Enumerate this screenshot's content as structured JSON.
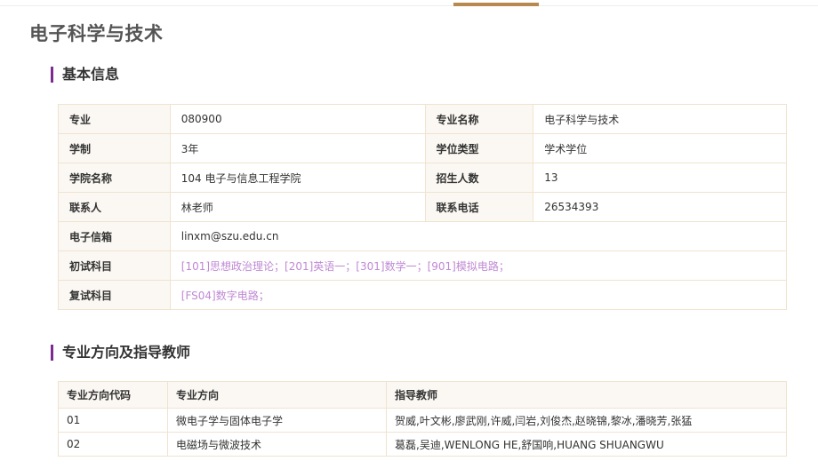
{
  "page_title": "电子科学与技术",
  "sections": {
    "basic_info": "基本信息",
    "directions": "专业方向及指导教师"
  },
  "info": {
    "major_label": "专业",
    "major_value": "080900",
    "major_name_label": "专业名称",
    "major_name_value": "电子科学与技术",
    "duration_label": "学制",
    "duration_value": "3年",
    "degree_type_label": "学位类型",
    "degree_type_value": "学术学位",
    "school_label": "学院名称",
    "school_value": "104 电子与信息工程学院",
    "enrollment_label": "招生人数",
    "enrollment_value": "13",
    "contact_label": "联系人",
    "contact_value": "林老师",
    "phone_label": "联系电话",
    "phone_value": "26534393",
    "email_label": "电子信箱",
    "email_value": "linxm@szu.edu.cn",
    "prelim_label": "初试科目",
    "prelim_value": "[101]思想政治理论；[201]英语一；[301]数学一；[901]模拟电路；",
    "retest_label": "复试科目",
    "retest_value": "[FS04]数字电路；"
  },
  "directions_table": {
    "headers": [
      "专业方向代码",
      "专业方向",
      "指导教师"
    ],
    "rows": [
      [
        "01",
        "微电子学与固体电子学",
        "贺威,叶文彬,廖武刚,许威,闫岩,刘俊杰,赵晓锦,黎冰,潘晓芳,张猛"
      ],
      [
        "02",
        "电磁场与微波技术",
        "葛磊,吴迪,WENLONG HE,舒国响,HUANG SHUANGWU"
      ]
    ]
  },
  "colors": {
    "accent_tab": "#b8894e",
    "section_marker": "#7b2c8f",
    "subject_link": "#c089d4",
    "table_border": "#f0e3cf",
    "label_bg": "#fbf8f3"
  }
}
